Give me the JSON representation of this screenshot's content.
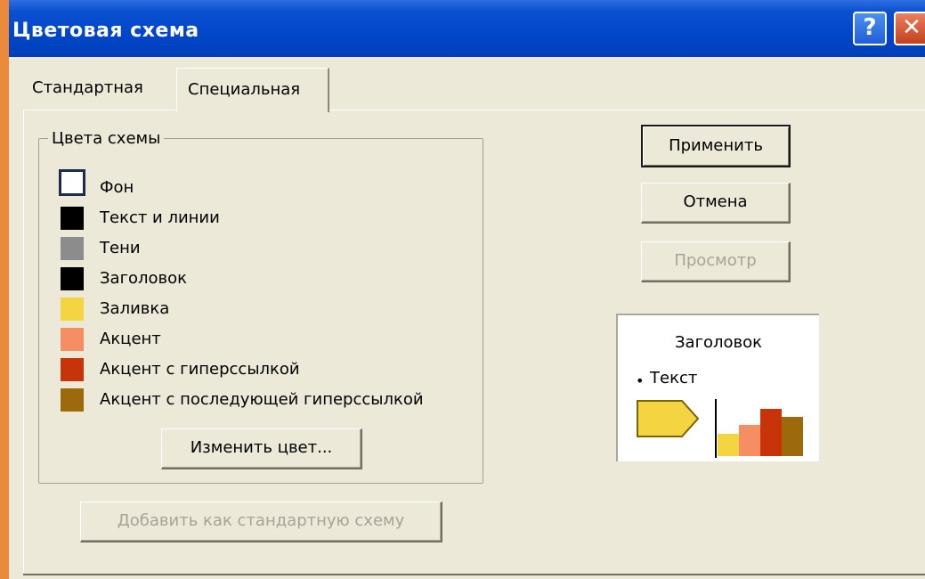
{
  "window": {
    "title": "Цветовая схема",
    "help_glyph": "?",
    "close_glyph": "✕"
  },
  "tabs": [
    {
      "label": "Стандартная",
      "active": false
    },
    {
      "label": "Специальная",
      "active": true
    }
  ],
  "scheme_group": {
    "title": "Цвета схемы",
    "items": [
      {
        "label": "Фон",
        "color": "#ffffff",
        "selected": true
      },
      {
        "label": "Текст и линии",
        "color": "#000000",
        "selected": false
      },
      {
        "label": "Тени",
        "color": "#8c8c8c",
        "selected": false
      },
      {
        "label": "Заголовок",
        "color": "#000000",
        "selected": false
      },
      {
        "label": "Заливка",
        "color": "#f5d442",
        "selected": false
      },
      {
        "label": "Акцент",
        "color": "#f58f63",
        "selected": false
      },
      {
        "label": "Акцент с гиперссылкой",
        "color": "#c8340a",
        "selected": false
      },
      {
        "label": "Акцент с последующей гиперссылкой",
        "color": "#9c6a0a",
        "selected": false
      }
    ],
    "change_color_button": "Изменить цвет..."
  },
  "buttons": {
    "apply": "Применить",
    "cancel": "Отмена",
    "preview": "Просмотр",
    "add_as_standard": "Добавить как стандартную схему"
  },
  "preview_box": {
    "title": "Заголовок",
    "bullet": "•",
    "text": "Текст",
    "bar_colors": [
      "#f5d442",
      "#f58f63",
      "#c8340a",
      "#9c6a0a"
    ],
    "bar_levels": [
      0.39,
      0.55,
      0.83,
      0.69
    ]
  }
}
